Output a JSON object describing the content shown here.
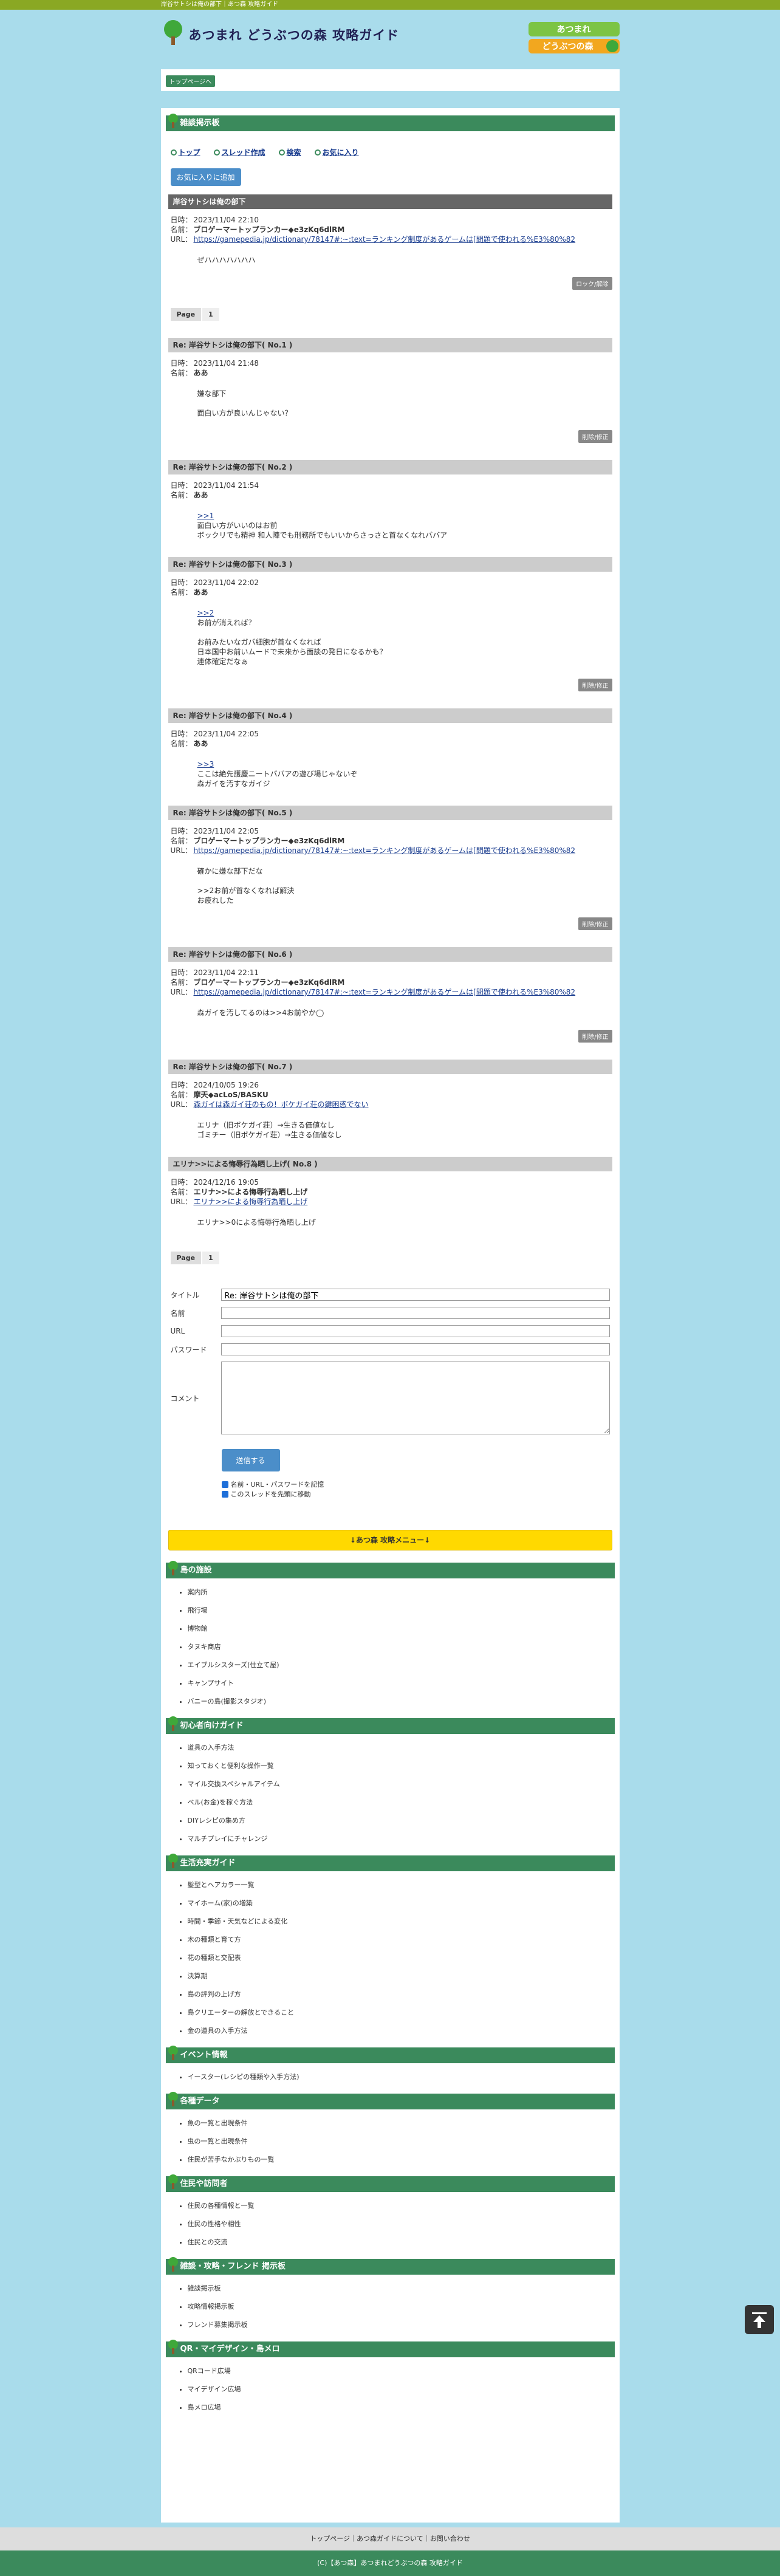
{
  "topbar": {
    "text": "岸谷サトシは俺の部下｜あつ森 攻略ガイド"
  },
  "header": {
    "title": "あつまれ どうぶつの森 攻略ガイド",
    "logo_top": "あつまれ",
    "logo_bottom": "どうぶつの森"
  },
  "breadcrumb": {
    "home": "トップページへ"
  },
  "section_title": "雑談掲示板",
  "nav": {
    "items": [
      "トップ",
      "スレッド作成",
      "検索",
      "お気に入り"
    ]
  },
  "fav_button": "お気に入りに追加",
  "labels": {
    "date": "日時：",
    "name": "名前：",
    "url": "URL："
  },
  "thread": {
    "title": "岸谷サトシは俺の部下",
    "date": "2023/11/04 22:10",
    "name": "ブロゲーマートップランカー◆e3zKq6dlRM",
    "url": "https://gamepedia.jp/dictionary/78147#:~:text=ランキング制度があるゲームは[問題で使われる%E3%80%82",
    "body": "ぜハハハハハハハ",
    "actions": [
      "ロック/解除"
    ]
  },
  "pager": {
    "label": "Page",
    "current": "1"
  },
  "replies": [
    {
      "title": "Re: 岸谷サトシは俺の部下( No.1 )",
      "date": "2023/11/04 21:48",
      "name": "ああ",
      "url": "",
      "body": "嫌な部下\n\n面白い方が良いんじゃない？",
      "action": "削除/修正"
    },
    {
      "title": "Re: 岸谷サトシは俺の部下( No.2 )",
      "date": "2023/11/04 21:54",
      "name": "ああ",
      "url": "",
      "body_link": ">>1",
      "body": "面白い方がいいのはお前\nボックリでも精神 和人陣でも刑務所でもいいからさっさと首なくなれババア",
      "action": ""
    },
    {
      "title": "Re: 岸谷サトシは俺の部下( No.3 )",
      "date": "2023/11/04 22:02",
      "name": "ああ",
      "url": "",
      "body_link": ">>2",
      "body": "お前が消えれば？\n\nお前みたいなガバ細胞が首なくなれば\n日本国中お前いムードで未来から面談の発日になるかも？\n連体確定だなぁ",
      "action": "削除/修正"
    },
    {
      "title": "Re: 岸谷サトシは俺の部下( No.4 )",
      "date": "2023/11/04 22:05",
      "name": "ああ",
      "url": "",
      "body_link": ">>3",
      "body": "ここは絶先護慶ニートババアの遊び場じゃないぞ\n森ガイを汚すなガイジ",
      "action": ""
    },
    {
      "title": "Re: 岸谷サトシは俺の部下( No.5 )",
      "date": "2023/11/04 22:05",
      "name": "ブロゲーマートップランカー◆e3zKq6dlRM",
      "url": "https://gamepedia.jp/dictionary/78147#:~:text=ランキング制度があるゲームは[問題で使われる%E3%80%82",
      "body": "確かに嫌な部下だな\n\n>>2お前が首なくなれば解決\nお疲れした",
      "action": "削除/修正"
    },
    {
      "title": "Re: 岸谷サトシは俺の部下( No.6 )",
      "date": "2023/11/04 22:11",
      "name": "ブロゲーマートップランカー◆e3zKq6dlRM",
      "url": "https://gamepedia.jp/dictionary/78147#:~:text=ランキング制度があるゲームは[問題で使われる%E3%80%82",
      "body": "森ガイを汚してるのは>>4お前やか◯",
      "action": "削除/修正"
    },
    {
      "title": "Re: 岸谷サトシは俺の部下( No.7 )",
      "date": "2024/10/05 19:26",
      "name": "摩天◆acLoS/BASKU",
      "url": "森ガイは森ガイ荘のもの！ボケガイ荘の鍵困惑でない",
      "body": "エリナ（旧ボケガイ荘）→生きる価値なし\nゴミチー（旧ボケガイ荘）→生きる価値なし",
      "action": ""
    },
    {
      "title": "エリナ>>による悔辱行為晒し上げ( No.8 )",
      "date": "2024/12/16 19:05",
      "name": "エリナ>>による悔辱行為晒し上げ",
      "url": "エリナ>>による悔辱行為晒し上げ",
      "body": "エリナ>>0による悔辱行為晒し上げ",
      "action": ""
    }
  ],
  "form": {
    "title_label": "タイトル",
    "title_value": "Re: 岸谷サトシは俺の部下",
    "name_label": "名前",
    "url_label": "URL",
    "password_label": "パスワード",
    "comment_label": "コメント",
    "submit": "送信する",
    "check1": "名前・URL・パスワードを記憶",
    "check2": "このスレッドを先頭に移動"
  },
  "menu_button": "↓あつ森 攻略メニュー↓",
  "categories": [
    {
      "title": "島の施設",
      "items": [
        "案内所",
        "飛行場",
        "博物館",
        "タヌキ商店",
        "エイブルシスターズ(仕立て屋)",
        "キャンプサイト",
        "バニーの島(撮影スタジオ)"
      ]
    },
    {
      "title": "初心者向けガイド",
      "items": [
        "道具の入手方法",
        "知っておくと便利な操作一覧",
        "マイル交換スペシャルアイテム",
        "ベル(お金)を稼ぐ方法",
        "DIYレシピの集め方",
        "マルチプレイにチャレンジ"
      ]
    },
    {
      "title": "生活充実ガイド",
      "items": [
        "髪型とヘアカラー一覧",
        "マイホーム(家)の増築",
        "時間・季節・天気などによる変化",
        "木の種類と育て方",
        "花の種類と交配表",
        "決算期",
        "島の評判の上げ方",
        "島クリエーターの解放とできること",
        "金の道具の入手方法"
      ]
    },
    {
      "title": "イベント情報",
      "items": [
        "イースター(レシピの種類や入手方法)"
      ]
    },
    {
      "title": "各種データ",
      "items": [
        "魚の一覧と出現条件",
        "虫の一覧と出現条件",
        "住民が苦手なかぶりもの一覧"
      ]
    },
    {
      "title": "住民や訪問者",
      "items": [
        "住民の各種情報と一覧",
        "住民の性格や相性",
        "住民との交流"
      ]
    },
    {
      "title": "雑談・攻略・フレンド 掲示板",
      "items": [
        "雑談掲示板",
        "攻略情報掲示板",
        "フレンド募集掲示板"
      ]
    },
    {
      "title": "QR・マイデザイン・島メロ",
      "items": [
        "QRコード広場",
        "マイデザイン広場",
        "島メロ広場"
      ]
    }
  ],
  "footer": {
    "links": "トップページ｜あつ森ガイドについて｜お問い合わせ",
    "copyright": "(C)【あつ森】あつまれどうぶつの森 攻略ガイド"
  },
  "colors": {
    "accent_green": "#3b8a5c",
    "topbar": "#8aa823",
    "button_blue": "#4b8ec9",
    "menu_yellow": "#ffd900"
  }
}
